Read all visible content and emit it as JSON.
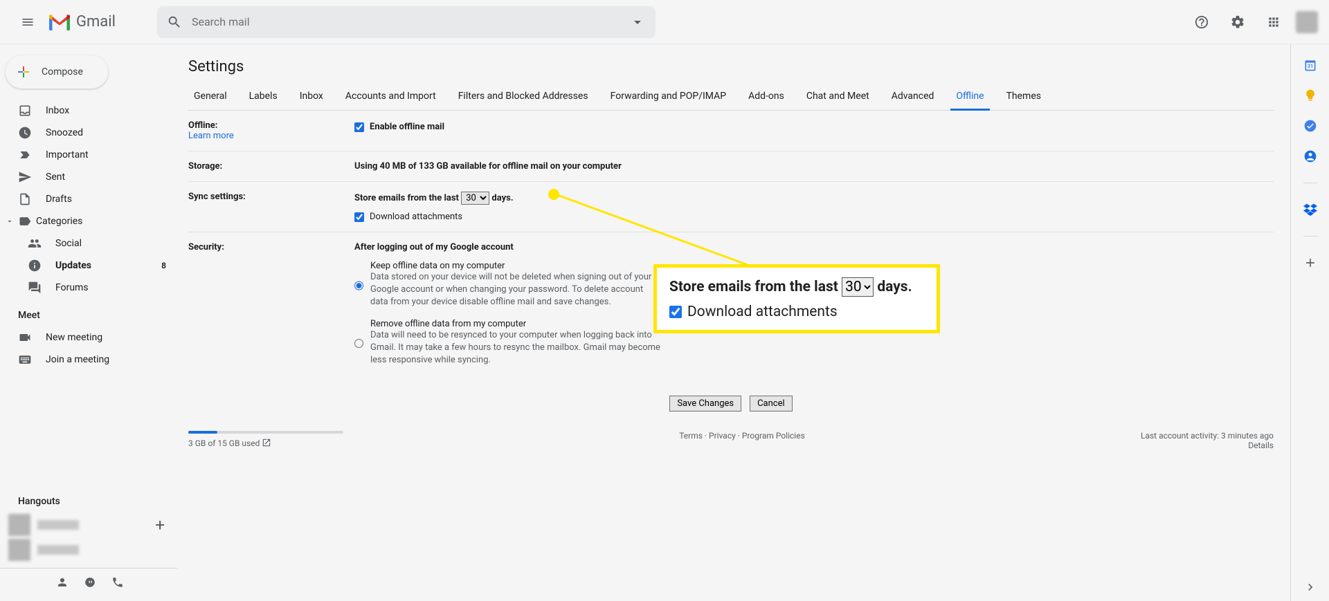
{
  "header": {
    "brand": "Gmail",
    "search_placeholder": "Search mail"
  },
  "compose_label": "Compose",
  "nav": {
    "inbox": "Inbox",
    "snoozed": "Snoozed",
    "important": "Important",
    "sent": "Sent",
    "drafts": "Drafts",
    "categories": "Categories",
    "social": "Social",
    "updates": "Updates",
    "updates_count": "8",
    "forums": "Forums"
  },
  "meet": {
    "header": "Meet",
    "new_meeting": "New meeting",
    "join_meeting": "Join a meeting"
  },
  "hangouts_header": "Hangouts",
  "page_title": "Settings",
  "tabs": [
    "General",
    "Labels",
    "Inbox",
    "Accounts and Import",
    "Filters and Blocked Addresses",
    "Forwarding and POP/IMAP",
    "Add-ons",
    "Chat and Meet",
    "Advanced",
    "Offline",
    "Themes"
  ],
  "active_tab": "Offline",
  "offline": {
    "label": "Offline:",
    "learn_more": "Learn more",
    "enable_label": "Enable offline mail"
  },
  "storage": {
    "label": "Storage:",
    "text": "Using 40 MB of 133 GB available for offline mail on your computer"
  },
  "sync": {
    "label": "Sync settings:",
    "prefix": "Store emails from the last",
    "value": "30",
    "suffix": "days.",
    "download_label": "Download attachments"
  },
  "security": {
    "label": "Security:",
    "heading": "After logging out of my Google account",
    "opt1_title": "Keep offline data on my computer",
    "opt1_desc": "Data stored on your device will not be deleted when signing out of your Google account or when changing your password. To delete account data from your device disable offline mail and save changes.",
    "opt2_title": "Remove offline data from my computer",
    "opt2_desc": "Data will need to be resynced to your computer when logging back into Gmail. It may take a few hours to resync the mailbox. Gmail may become less responsive while syncing."
  },
  "buttons": {
    "save": "Save Changes",
    "cancel": "Cancel"
  },
  "footer": {
    "quota": "3 GB of 15 GB used",
    "terms": "Terms",
    "privacy": "Privacy",
    "policies": "Program Policies",
    "activity": "Last account activity: 3 minutes ago",
    "details": "Details"
  },
  "callout": {
    "prefix": "Store emails from the last",
    "value": "30",
    "suffix": "days.",
    "download_label": "Download attachments"
  }
}
